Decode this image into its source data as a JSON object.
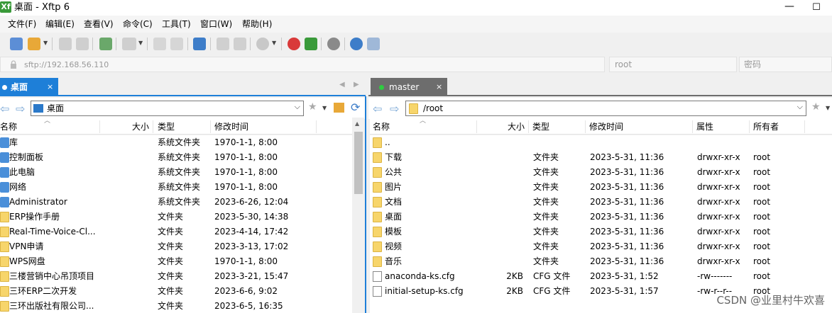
{
  "window": {
    "app_icon": "Xf",
    "title": "桌面 - Xftp 6",
    "minimize": "—",
    "maximize": "☐"
  },
  "menu": [
    "文件(F)",
    "编辑(E)",
    "查看(V)",
    "命令(C)",
    "工具(T)",
    "窗口(W)",
    "帮助(H)"
  ],
  "address": {
    "value": "sftp://192.168.56.110",
    "user_placeholder": "root",
    "password_placeholder": "密码"
  },
  "left_pane": {
    "tab_label": "桌面",
    "tab_close": "×",
    "path": "桌面",
    "columns": [
      "名称",
      "大小",
      "类型",
      "修改时间"
    ],
    "rows": [
      {
        "name": "库",
        "size": "",
        "type": "系统文件夹",
        "modified": "1970-1-1, 8:00",
        "icon": "library-icon"
      },
      {
        "name": "控制面板",
        "size": "",
        "type": "系统文件夹",
        "modified": "1970-1-1, 8:00",
        "icon": "control-panel-icon"
      },
      {
        "name": "此电脑",
        "size": "",
        "type": "系统文件夹",
        "modified": "1970-1-1, 8:00",
        "icon": "computer-icon"
      },
      {
        "name": "网络",
        "size": "",
        "type": "系统文件夹",
        "modified": "1970-1-1, 8:00",
        "icon": "network-icon"
      },
      {
        "name": "Administrator",
        "size": "",
        "type": "系统文件夹",
        "modified": "2023-6-26, 12:04",
        "icon": "user-icon"
      },
      {
        "name": "ERP操作手册",
        "size": "",
        "type": "文件夹",
        "modified": "2023-5-30, 14:38",
        "icon": "folder-icon"
      },
      {
        "name": "Real-Time-Voice-Cl...",
        "size": "",
        "type": "文件夹",
        "modified": "2023-4-14, 17:42",
        "icon": "folder-icon"
      },
      {
        "name": "VPN申请",
        "size": "",
        "type": "文件夹",
        "modified": "2023-3-13, 17:02",
        "icon": "folder-icon"
      },
      {
        "name": "WPS网盘",
        "size": "",
        "type": "文件夹",
        "modified": "1970-1-1, 8:00",
        "icon": "folder-icon"
      },
      {
        "name": "三楼营销中心吊顶项目",
        "size": "",
        "type": "文件夹",
        "modified": "2023-3-21, 15:47",
        "icon": "folder-icon"
      },
      {
        "name": "三环ERP二次开发",
        "size": "",
        "type": "文件夹",
        "modified": "2023-6-6, 9:02",
        "icon": "folder-icon"
      },
      {
        "name": "三环出版社有限公司...",
        "size": "",
        "type": "文件夹",
        "modified": "2023-6-5, 16:35",
        "icon": "folder-icon"
      }
    ]
  },
  "right_pane": {
    "tab_label": "master",
    "tab_close": "×",
    "path": "/root",
    "columns": [
      "名称",
      "大小",
      "类型",
      "修改时间",
      "属性",
      "所有者"
    ],
    "rows": [
      {
        "name": "..",
        "size": "",
        "type": "",
        "modified": "",
        "attr": "",
        "owner": "",
        "icon": "folder-icon"
      },
      {
        "name": "下载",
        "size": "",
        "type": "文件夹",
        "modified": "2023-5-31, 11:36",
        "attr": "drwxr-xr-x",
        "owner": "root",
        "icon": "folder-icon"
      },
      {
        "name": "公共",
        "size": "",
        "type": "文件夹",
        "modified": "2023-5-31, 11:36",
        "attr": "drwxr-xr-x",
        "owner": "root",
        "icon": "folder-icon"
      },
      {
        "name": "图片",
        "size": "",
        "type": "文件夹",
        "modified": "2023-5-31, 11:36",
        "attr": "drwxr-xr-x",
        "owner": "root",
        "icon": "folder-icon"
      },
      {
        "name": "文档",
        "size": "",
        "type": "文件夹",
        "modified": "2023-5-31, 11:36",
        "attr": "drwxr-xr-x",
        "owner": "root",
        "icon": "folder-icon"
      },
      {
        "name": "桌面",
        "size": "",
        "type": "文件夹",
        "modified": "2023-5-31, 11:36",
        "attr": "drwxr-xr-x",
        "owner": "root",
        "icon": "folder-icon"
      },
      {
        "name": "模板",
        "size": "",
        "type": "文件夹",
        "modified": "2023-5-31, 11:36",
        "attr": "drwxr-xr-x",
        "owner": "root",
        "icon": "folder-icon"
      },
      {
        "name": "视频",
        "size": "",
        "type": "文件夹",
        "modified": "2023-5-31, 11:36",
        "attr": "drwxr-xr-x",
        "owner": "root",
        "icon": "folder-icon"
      },
      {
        "name": "音乐",
        "size": "",
        "type": "文件夹",
        "modified": "2023-5-31, 11:36",
        "attr": "drwxr-xr-x",
        "owner": "root",
        "icon": "folder-icon"
      },
      {
        "name": "anaconda-ks.cfg",
        "size": "2KB",
        "type": "CFG 文件",
        "modified": "2023-5-31, 1:52",
        "attr": "-rw-------",
        "owner": "root",
        "icon": "file-icon"
      },
      {
        "name": "initial-setup-ks.cfg",
        "size": "2KB",
        "type": "CFG 文件",
        "modified": "2023-5-31, 1:57",
        "attr": "-rw-r--r--",
        "owner": "root",
        "icon": "file-icon"
      }
    ]
  },
  "watermark": "CSDN @业里村牛欢喜",
  "colors": {
    "active_tab": "#1e7fd8",
    "inactive_tab": "#6d6d6d",
    "tab_dot_left": "#ffffff",
    "tab_dot_right": "#2ecc40",
    "folder": "#f7d56b"
  }
}
